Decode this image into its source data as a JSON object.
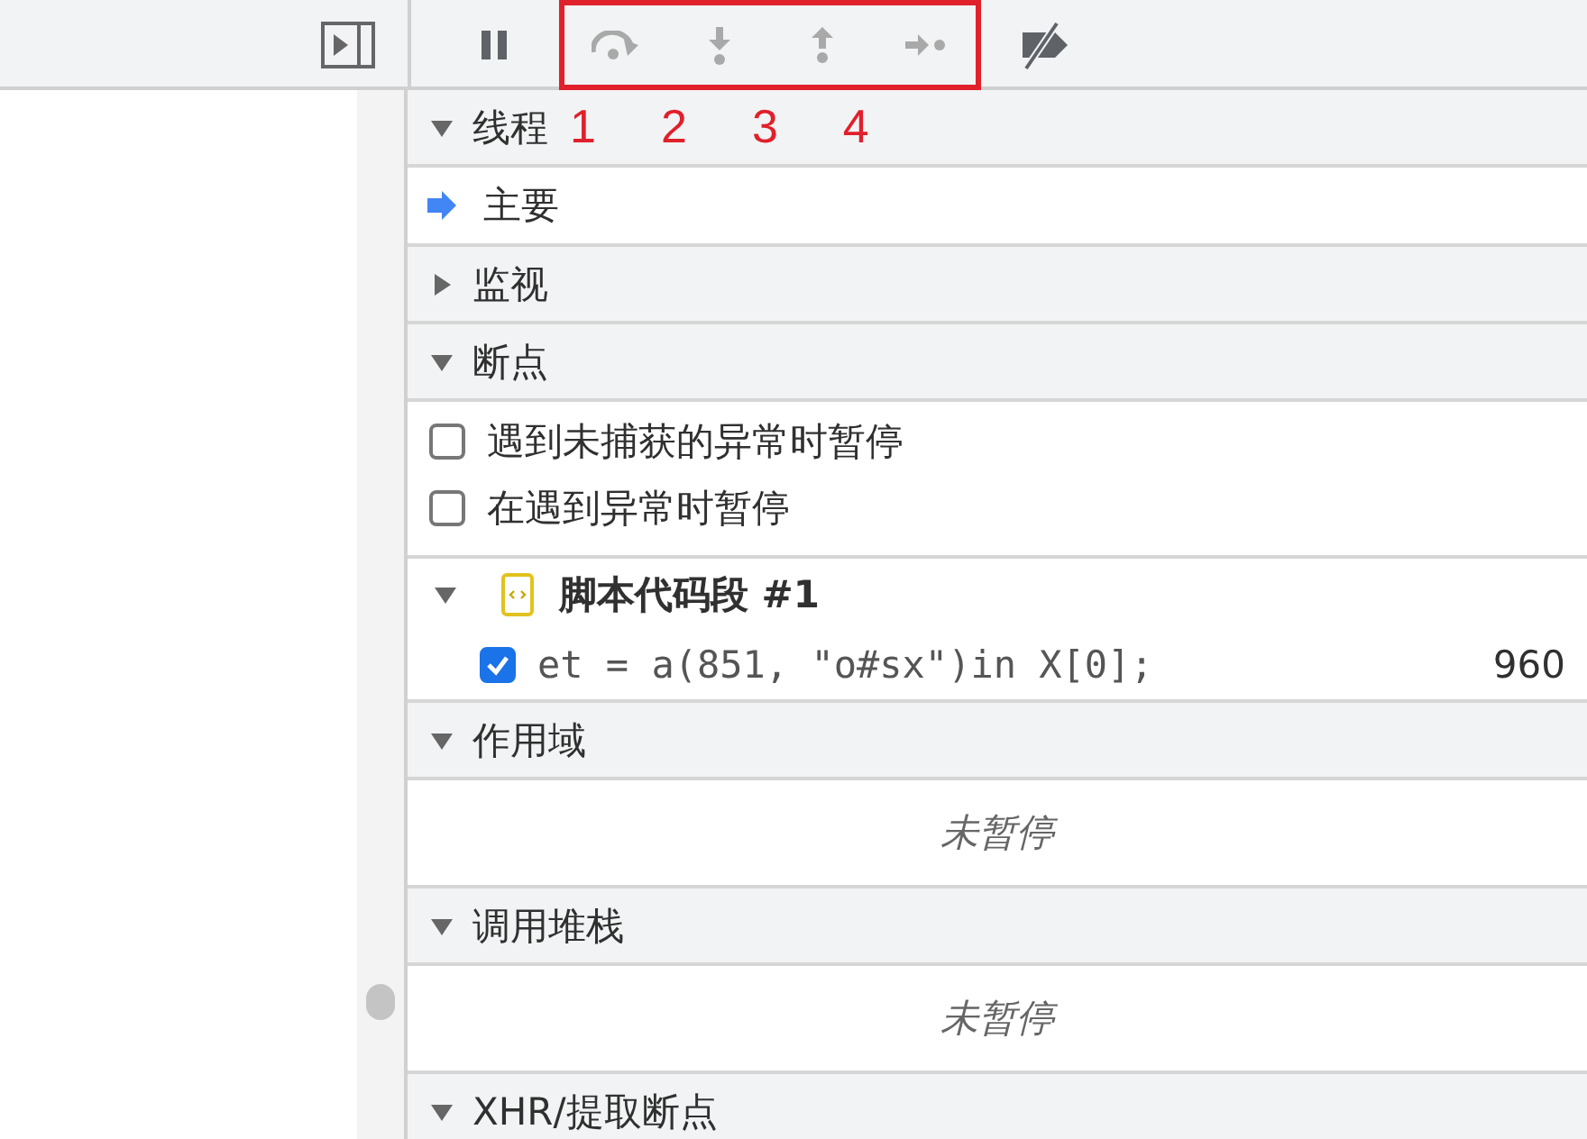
{
  "toolbar": {
    "buttons": [
      {
        "kind": "pause",
        "disabled": false
      },
      {
        "kind": "step-over",
        "disabled": true
      },
      {
        "kind": "step-into",
        "disabled": true
      },
      {
        "kind": "step-out",
        "disabled": true
      },
      {
        "kind": "step",
        "disabled": true
      },
      {
        "kind": "deactivate",
        "disabled": false
      }
    ]
  },
  "sections": [
    {
      "title": "线程",
      "expanded": true,
      "annotations": [
        "1",
        "2",
        "3",
        "4"
      ],
      "rows": [
        {
          "kind": "thread",
          "label": "主要",
          "selected": true
        }
      ]
    },
    {
      "title": "监视",
      "expanded": false
    },
    {
      "title": "断点",
      "expanded": true,
      "rows": [
        {
          "kind": "checkbox",
          "label": "遇到未捕获的异常时暂停",
          "checked": false
        },
        {
          "kind": "checkbox",
          "label": "在遇到异常时暂停",
          "checked": false
        },
        {
          "kind": "file",
          "label": "脚本代码段 #1",
          "expanded": true
        },
        {
          "kind": "breakpoint",
          "code": "et = a(851, \"o#sx\")in X[0];",
          "line": "960",
          "checked": true
        }
      ]
    },
    {
      "title": "作用域",
      "expanded": true,
      "rows": [
        {
          "kind": "message",
          "label": "未暂停"
        }
      ]
    },
    {
      "title": "调用堆栈",
      "expanded": true,
      "rows": [
        {
          "kind": "message",
          "label": "未暂停"
        }
      ]
    },
    {
      "title": "XHR/提取断点",
      "expanded": true
    }
  ]
}
